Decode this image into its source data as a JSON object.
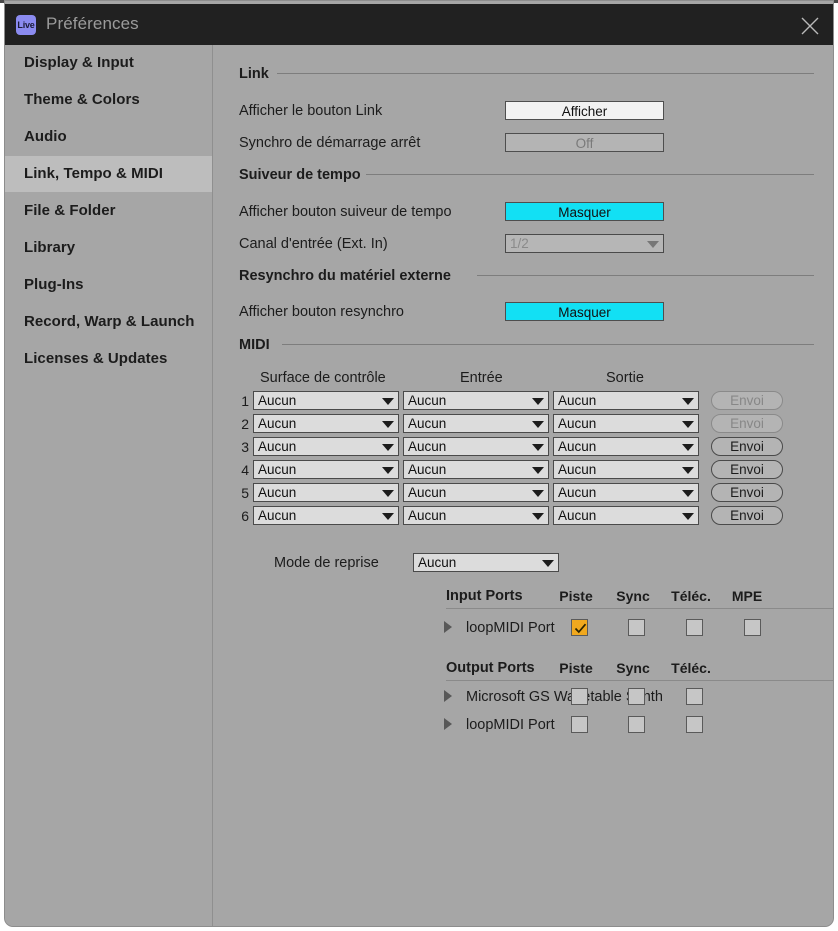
{
  "window": {
    "title": "Préférences",
    "logo_text": "Live",
    "close_icon": "close-icon"
  },
  "sidebar": {
    "items": [
      {
        "label": "Display & Input",
        "selected": false
      },
      {
        "label": "Theme & Colors",
        "selected": false
      },
      {
        "label": "Audio",
        "selected": false
      },
      {
        "label": "Link, Tempo & MIDI",
        "selected": true
      },
      {
        "label": "File & Folder",
        "selected": false
      },
      {
        "label": "Library",
        "selected": false
      },
      {
        "label": "Plug-Ins",
        "selected": false
      },
      {
        "label": "Record, Warp & Launch",
        "selected": false
      },
      {
        "label": "Licenses & Updates",
        "selected": false
      }
    ]
  },
  "sections": {
    "link": {
      "title": "Link",
      "rows": [
        {
          "label": "Afficher le bouton Link",
          "value": "Afficher",
          "state": "on"
        },
        {
          "label": "Synchro de démarrage arrêt",
          "value": "Off",
          "state": "off"
        }
      ]
    },
    "tempo_follower": {
      "title": "Suiveur de tempo",
      "button_row": {
        "label": "Afficher bouton suiveur de tempo",
        "value": "Masquer",
        "state": "cyan"
      },
      "dropdown_row": {
        "label": "Canal d'entrée (Ext. In)",
        "value": "1/2",
        "disabled": true
      }
    },
    "resync": {
      "title": "Resynchro du matériel externe",
      "button_row": {
        "label": "Afficher bouton resynchro",
        "value": "Masquer",
        "state": "cyan"
      }
    },
    "midi": {
      "title": "MIDI",
      "columns": [
        "Surface de contrôle",
        "Entrée",
        "Sortie"
      ],
      "rows": [
        {
          "num": "1",
          "control_surface": "Aucun",
          "input": "Aucun",
          "output": "Aucun",
          "send_label": "Envoi",
          "send_disabled": true
        },
        {
          "num": "2",
          "control_surface": "Aucun",
          "input": "Aucun",
          "output": "Aucun",
          "send_label": "Envoi",
          "send_disabled": true
        },
        {
          "num": "3",
          "control_surface": "Aucun",
          "input": "Aucun",
          "output": "Aucun",
          "send_label": "Envoi",
          "send_disabled": false
        },
        {
          "num": "4",
          "control_surface": "Aucun",
          "input": "Aucun",
          "output": "Aucun",
          "send_label": "Envoi",
          "send_disabled": false
        },
        {
          "num": "5",
          "control_surface": "Aucun",
          "input": "Aucun",
          "output": "Aucun",
          "send_label": "Envoi",
          "send_disabled": false
        },
        {
          "num": "6",
          "control_surface": "Aucun",
          "input": "Aucun",
          "output": "Aucun",
          "send_label": "Envoi",
          "send_disabled": false
        }
      ],
      "takeover": {
        "label": "Mode de reprise",
        "value": "Aucun"
      }
    },
    "input_ports": {
      "title": "Input Ports",
      "columns": [
        "Piste",
        "Sync",
        "Téléc.",
        "MPE"
      ],
      "rows": [
        {
          "name": "loopMIDI Port",
          "checks": [
            true,
            false,
            false,
            false
          ]
        }
      ]
    },
    "output_ports": {
      "title": "Output Ports",
      "columns": [
        "Piste",
        "Sync",
        "Téléc."
      ],
      "rows": [
        {
          "name": "Microsoft GS Wavetable Synth",
          "checks": [
            false,
            false,
            false
          ]
        },
        {
          "name": "loopMIDI Port",
          "checks": [
            false,
            false,
            false
          ]
        }
      ]
    }
  },
  "colors": {
    "accent_cyan": "#12e0f4",
    "accent_amber": "#f0a81e",
    "window_bg": "#a6a6a6",
    "titlebar_bg": "#212121",
    "logo_bg": "#8b8bf0"
  }
}
